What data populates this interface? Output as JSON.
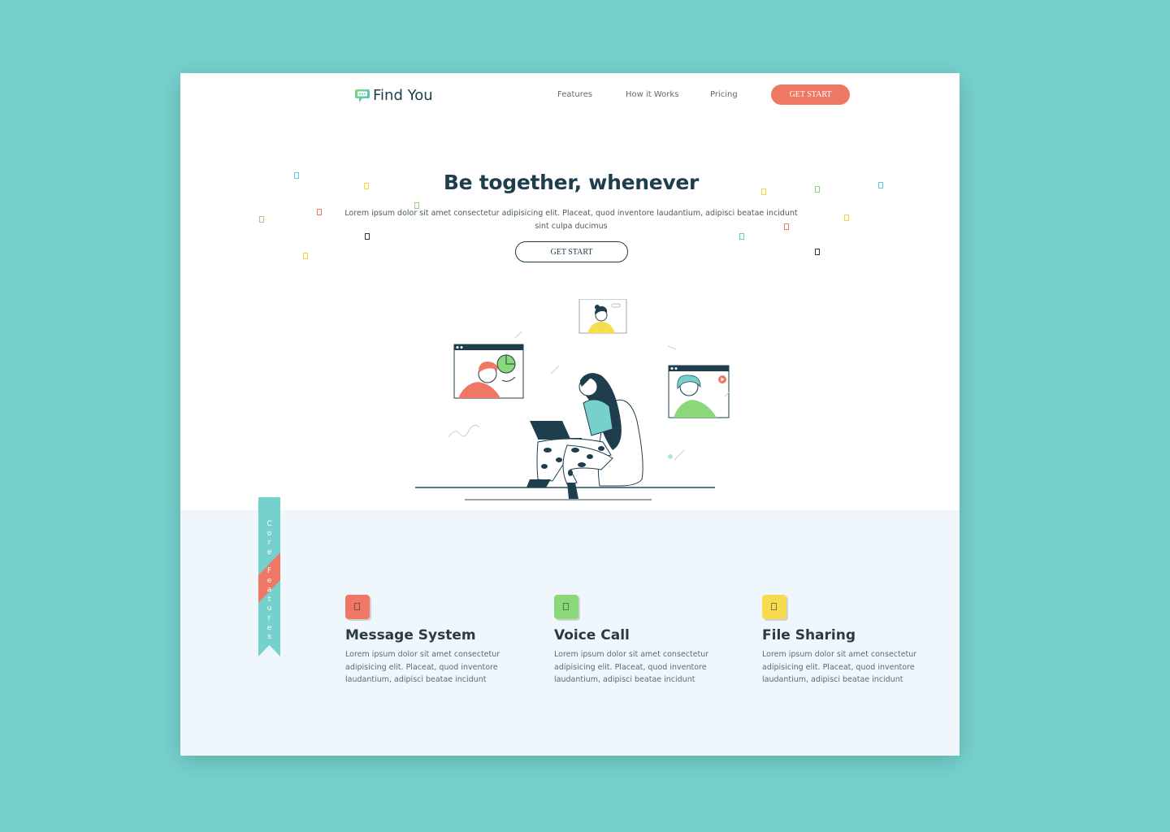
{
  "brand": {
    "name": "Find You",
    "accent": "#ef7864",
    "dark": "#1e3d4d",
    "teal": "#76d1cd"
  },
  "nav": {
    "links": [
      "Features",
      "How it Works",
      "Pricing"
    ],
    "cta_label": "GET START"
  },
  "hero": {
    "title": "Be together, whenever",
    "subtitle": "Lorem ipsum dolor sit amet consectetur adipisicing elit. Placeat, quod inventore laudantium, adipisci beatae incidunt sint culpa ducimus",
    "cta_label": "GET START",
    "illustration_icon": "video-call-illustration"
  },
  "features_section": {
    "ribbon_label": "Core Features",
    "items": [
      {
        "title": "Message System",
        "description": "Lorem ipsum dolor sit amet consectetur adipisicing elit. Placeat, quod inventore laudantium, adipisci beatae incidunt",
        "icon": "message-icon",
        "color": "#ef7864"
      },
      {
        "title": "Voice Call",
        "description": "Lorem ipsum dolor sit amet consectetur adipisicing elit. Placeat, quod inventore laudantium, adipisci beatae incidunt",
        "icon": "phone-icon",
        "color": "#8ad879"
      },
      {
        "title": "File Sharing",
        "description": "Lorem ipsum dolor sit amet consectetur adipisicing elit. Placeat, quod inventore laudantium, adipisci beatae incidunt",
        "icon": "file-icon",
        "color": "#f6dc4e"
      }
    ]
  }
}
